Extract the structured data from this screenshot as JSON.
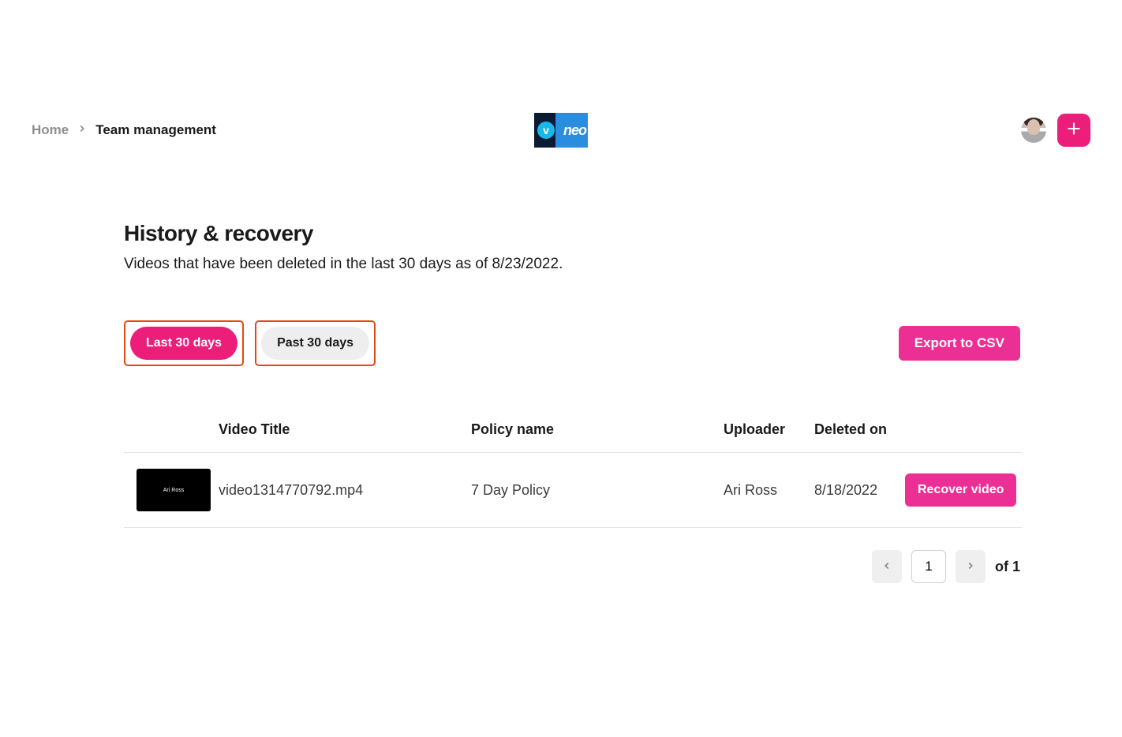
{
  "breadcrumb": {
    "home": "Home",
    "current": "Team management"
  },
  "logo_text": "neo",
  "page": {
    "title": "History & recovery",
    "subtitle": "Videos that have been deleted in the last 30 days as of 8/23/2022."
  },
  "filters": {
    "last30": "Last 30 days",
    "past30": "Past 30 days",
    "active": "last30"
  },
  "export_label": "Export to CSV",
  "table": {
    "headers": {
      "thumb": "",
      "title": "Video Title",
      "policy": "Policy name",
      "uploader": "Uploader",
      "deleted": "Deleted on",
      "action": ""
    },
    "rows": [
      {
        "thumb_label": "Ari Ross",
        "title": "video1314770792.mp4",
        "policy": "7 Day Policy",
        "uploader": "Ari Ross",
        "deleted": "8/18/2022",
        "action": "Recover video"
      }
    ]
  },
  "pager": {
    "page": "1",
    "of_label": "of 1"
  }
}
